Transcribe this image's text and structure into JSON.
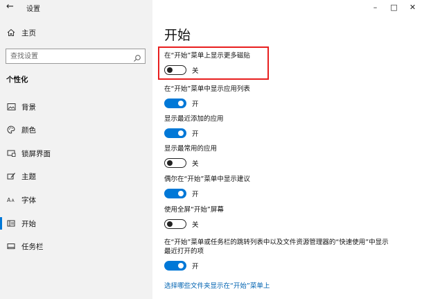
{
  "window": {
    "title": "设置",
    "back_glyph": "←",
    "minimize_glyph": "–",
    "maximize_glyph": "□",
    "close_glyph": "✕"
  },
  "sidebar": {
    "home_label": "主页",
    "search_placeholder": "查找设置",
    "section_heading": "个性化",
    "items": [
      {
        "label": "背景",
        "icon": "image-icon"
      },
      {
        "label": "颜色",
        "icon": "palette-icon"
      },
      {
        "label": "锁屏界面",
        "icon": "lock-screen-icon"
      },
      {
        "label": "主题",
        "icon": "brush-icon"
      },
      {
        "label": "字体",
        "icon": "font-icon"
      },
      {
        "label": "开始",
        "icon": "start-icon",
        "selected": true
      },
      {
        "label": "任务栏",
        "icon": "taskbar-icon"
      }
    ],
    "font_glyph": "Aᴬ"
  },
  "main": {
    "title": "开始",
    "settings": [
      {
        "label": "在“开始”菜单上显示更多磁贴",
        "state": "关",
        "on": false
      },
      {
        "label": "在“开始”菜单中显示应用列表",
        "state": "开",
        "on": true
      },
      {
        "label": "显示最近添加的应用",
        "state": "开",
        "on": true
      },
      {
        "label": "显示最常用的应用",
        "state": "关",
        "on": false
      },
      {
        "label": "偶尔在“开始”菜单中显示建议",
        "state": "开",
        "on": true
      },
      {
        "label": "使用全屏“开始”屏幕",
        "state": "关",
        "on": false
      },
      {
        "label": "在“开始”菜单或任务栏的跳转列表中以及文件资源管理器的“快速使用”中显示最近打开的项",
        "state": "开",
        "on": true
      }
    ],
    "footer_link": "选择哪些文件夹显示在“开始”菜单上"
  },
  "colors": {
    "accent": "#0078d7",
    "highlight_border": "#e81e1e",
    "sidebar_bg": "#f2f2f2",
    "link": "#0063b1"
  }
}
